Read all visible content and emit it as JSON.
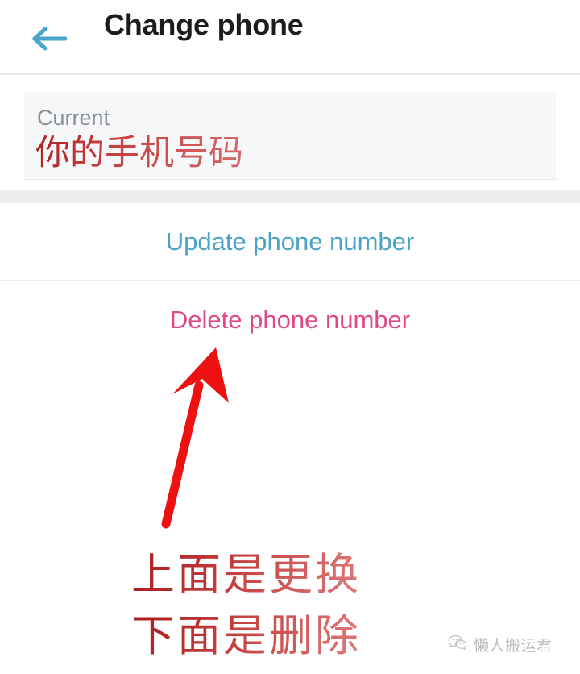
{
  "header": {
    "title": "Change phone",
    "back_icon": "arrow-left-icon",
    "back_icon_color": "#4aa7cc",
    "title_color": "#1b1c1e"
  },
  "field": {
    "label": "Current",
    "label_color": "#8c9196",
    "value": "你的手机号码",
    "value_color": "#bb2a2a",
    "background_color": "#f6f7f9"
  },
  "actions": [
    {
      "label": "Update phone number",
      "color": "#4aa3c7",
      "name": "update-phone-number-button"
    },
    {
      "label": "Delete phone number",
      "color": "#de4a86",
      "name": "delete-phone-number-button"
    }
  ],
  "annotations": {
    "arrow": {
      "icon": "red-arrow-annotation",
      "color": "#ee1111",
      "points_to": "Delete phone number"
    },
    "lines": [
      "上面是更换",
      "下面是删除"
    ],
    "text_color": "#c02a2a"
  },
  "watermark": {
    "icon": "wechat-icon",
    "text": "懒人搬运君"
  }
}
